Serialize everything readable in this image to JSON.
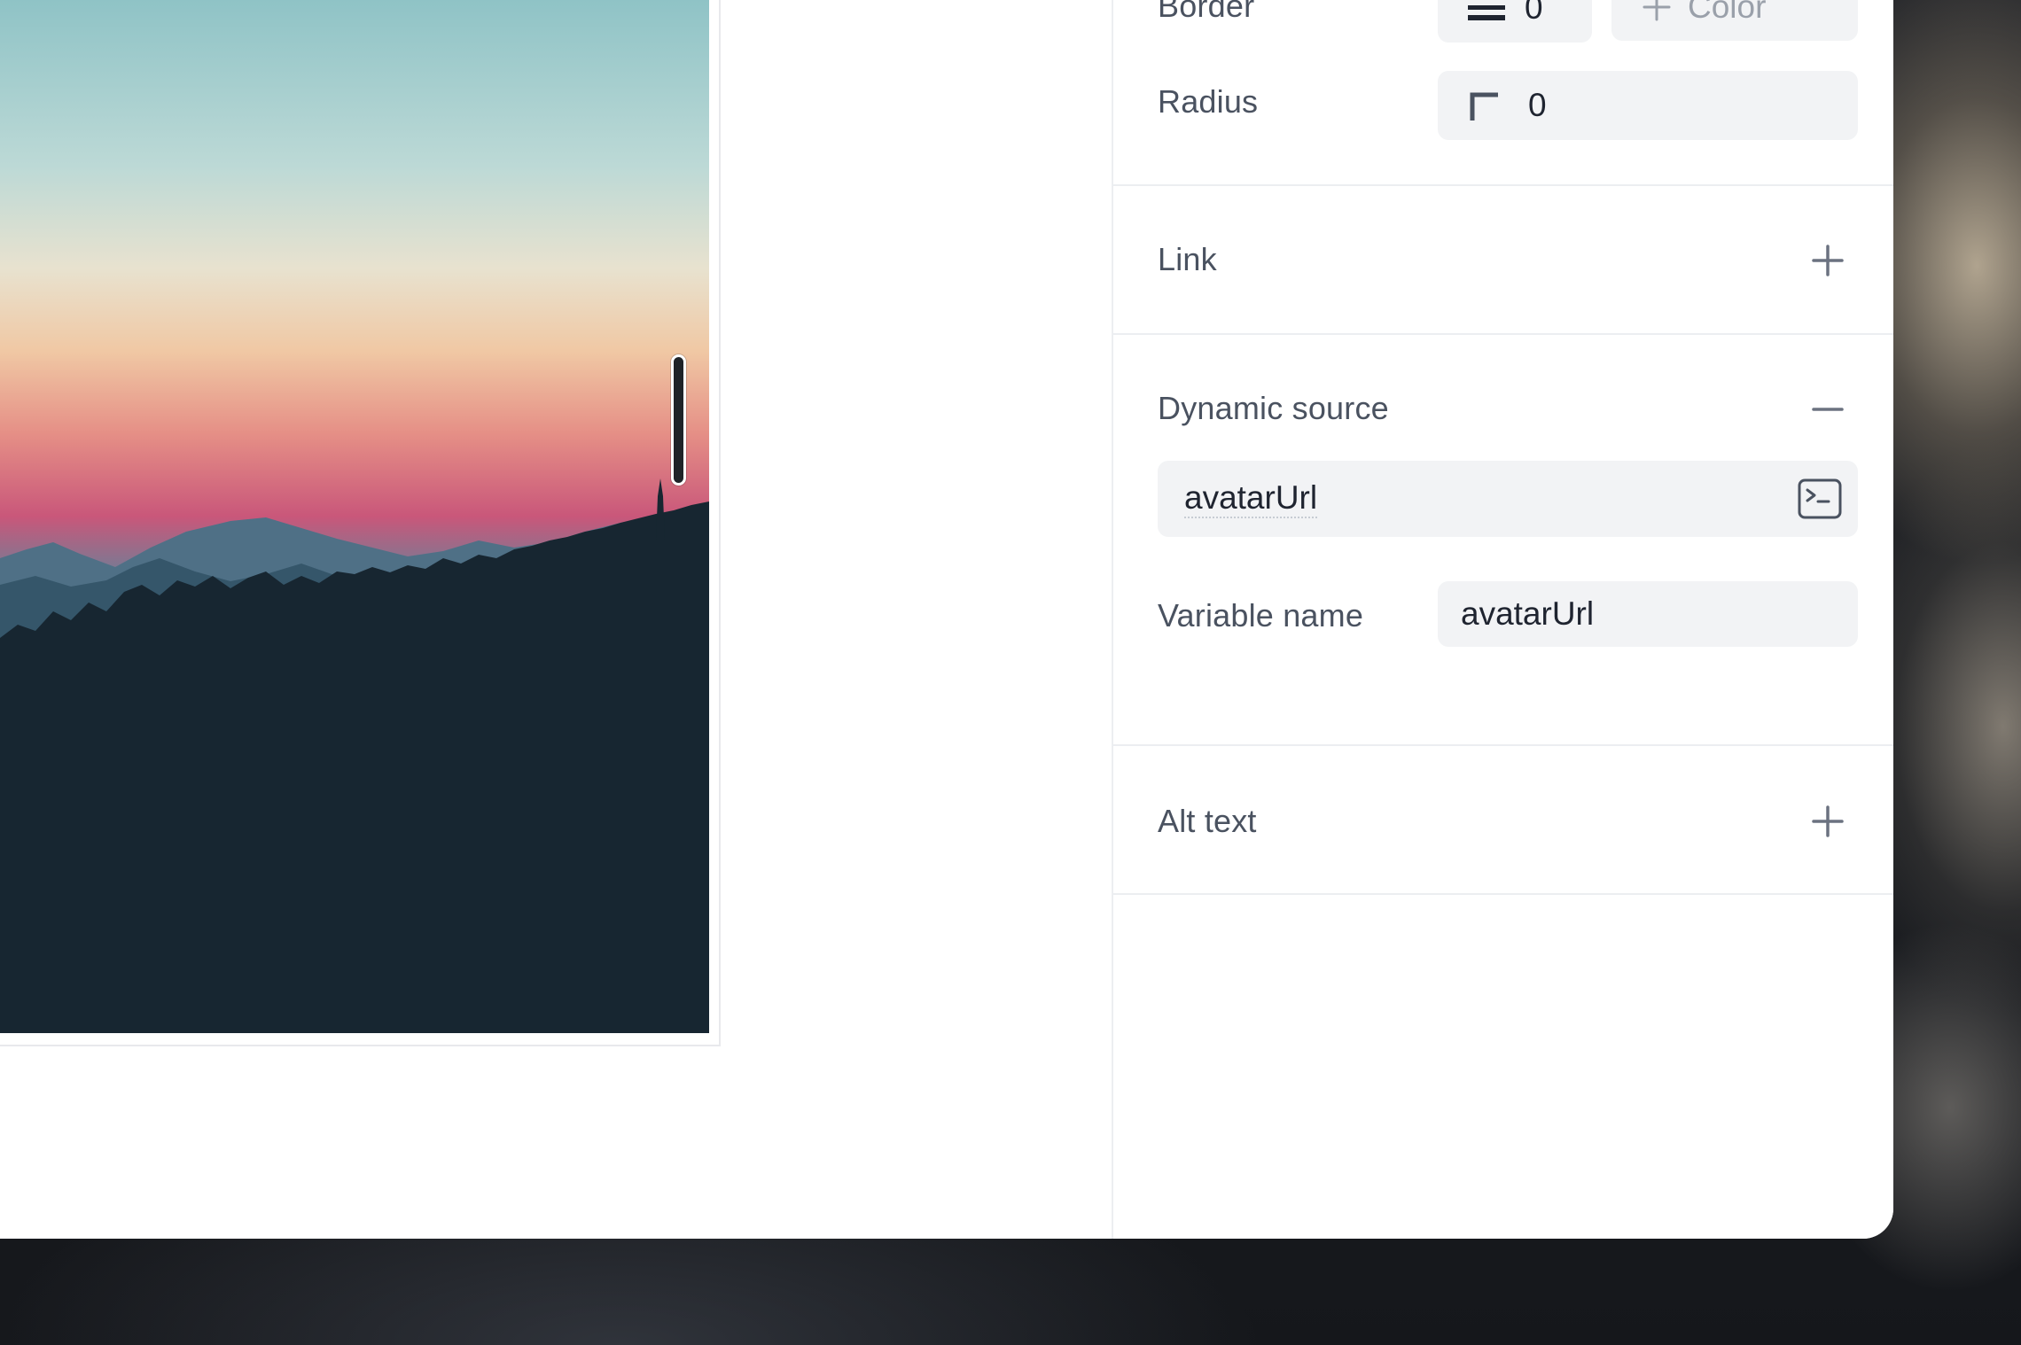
{
  "panel": {
    "border": {
      "label": "Border",
      "width_value": "0",
      "color_label": "Color"
    },
    "radius": {
      "label": "Radius",
      "value": "0"
    },
    "link": {
      "label": "Link"
    },
    "dynamic_source": {
      "label": "Dynamic source",
      "source_value": "avatarUrl",
      "variable_label": "Variable name",
      "variable_value": "avatarUrl"
    },
    "alt_text": {
      "label": "Alt text"
    }
  },
  "icons": {
    "border_width": "border-width-icon",
    "color_add": "plus-icon",
    "radius": "corner-radius-icon",
    "link_add": "plus-icon",
    "dynamic_collapse": "minus-icon",
    "terminal": "terminal-icon",
    "alt_add": "plus-icon"
  },
  "colors": {
    "label": "#4a5260",
    "field_bg": "#f2f3f5",
    "icon": "#6b7280",
    "handle": "#1f2328"
  }
}
